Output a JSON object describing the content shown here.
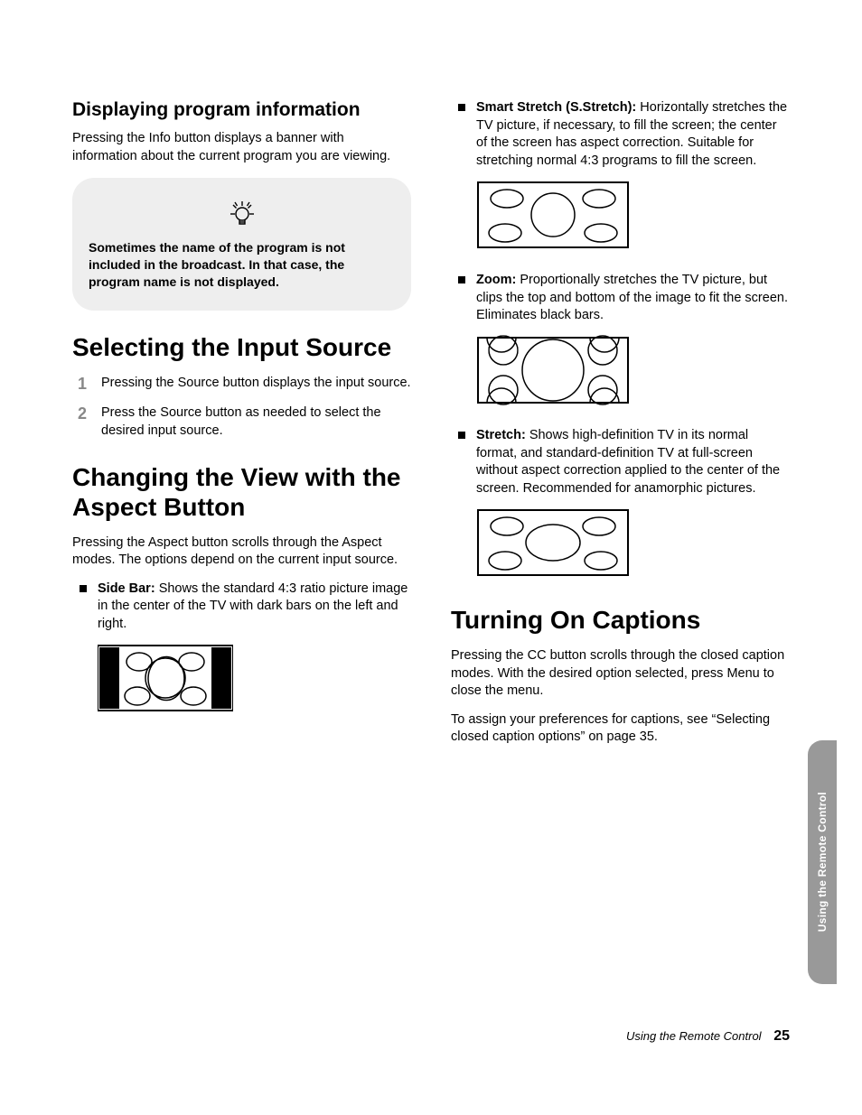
{
  "left": {
    "h_display": "Displaying program information",
    "p_display": "Pressing the Info button displays a banner with information about the current program you are viewing.",
    "tip": "Sometimes the name of the program is not included in the broadcast. In that case, the program name is not displayed.",
    "h_select": "Selecting the Input Source",
    "steps": [
      "Pressing the Source button displays the input source.",
      "Press the Source button as needed to select the desired input source."
    ],
    "h_aspect": "Changing the View with the Aspect Button",
    "p_aspect": "Pressing the Aspect button scrolls through the Aspect modes. The options depend on the current input source.",
    "sidebar_label": "Side Bar:",
    "sidebar_text": " Shows the standard 4:3 ratio picture image in the center of the TV with dark bars on the left and right."
  },
  "right": {
    "smart_label": "Smart Stretch (S.Stretch):",
    "smart_text": " Horizontally stretches the TV picture, if necessary, to fill the screen; the center of the screen has aspect correction. Suitable for stretching normal 4:3 programs to fill the screen.",
    "zoom_label": "Zoom:",
    "zoom_text": " Proportionally stretches the TV picture, but clips the top and bottom of the image to fit the screen. Eliminates black bars.",
    "stretch_label": "Stretch:",
    "stretch_text": " Shows high-definition TV in its normal format, and standard-definition TV at full-screen without aspect correction applied to the center of the screen. Recommended for anamorphic pictures.",
    "h_captions": "Turning On Captions",
    "p_captions1": "Pressing the CC button scrolls through the closed caption modes. With the desired option selected, press Menu to close the menu.",
    "p_captions2": "To assign your preferences for captions, see “Selecting closed caption options” on page 35."
  },
  "footer": {
    "section": "Using the Remote Control",
    "page": "25"
  },
  "sidetab": "Using the Remote Control"
}
